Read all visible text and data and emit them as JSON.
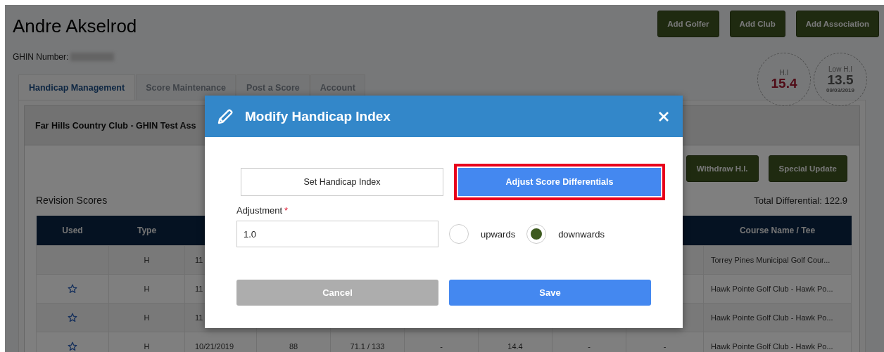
{
  "golfer": {
    "name": "Andre Akselrod",
    "ghin_label": "GHIN Number:"
  },
  "header_buttons": [
    "Add Golfer",
    "Add Club",
    "Add Association"
  ],
  "indexes": [
    {
      "label": "H.I",
      "value": "15.4",
      "kind": "current"
    },
    {
      "label": "Low H.I",
      "value": "13.5",
      "date": "09/03/2019",
      "kind": "low"
    }
  ],
  "tabs": [
    {
      "label": "Handicap Management",
      "selected": true
    },
    {
      "label": "Score Maintenance",
      "selected": false
    },
    {
      "label": "Post a Score",
      "selected": false
    },
    {
      "label": "Account",
      "selected": false
    }
  ],
  "card": {
    "title": "Far Hills Country Club - GHIN Test Ass",
    "actions": [
      "Withdraw H.I.",
      "Special Update"
    ],
    "section_title": "Revision Scores",
    "total": "Total Differential: 122.9"
  },
  "table": {
    "columns": [
      "Used",
      "Type",
      "",
      "",
      "",
      "",
      "",
      "",
      "",
      "Course Name / Tee"
    ],
    "rows": [
      {
        "used": false,
        "cells": [
          "",
          "H",
          "11",
          "",
          "",
          "",
          "",
          "",
          "",
          "Torrey Pines Municipal Golf Cour..."
        ]
      },
      {
        "used": true,
        "cells": [
          "",
          "H",
          "11",
          "",
          "",
          "",
          "",
          "",
          "",
          "Hawk Pointe Golf Club - Hawk Po..."
        ]
      },
      {
        "used": true,
        "cells": [
          "",
          "H",
          "11",
          "",
          "",
          "",
          "",
          "",
          "",
          "Hawk Pointe Golf Club - Hawk Po..."
        ]
      },
      {
        "used": true,
        "cells": [
          "",
          "H",
          "10/21/2019",
          "88",
          "71.1 / 133",
          "-",
          "14.4",
          "-",
          "-",
          "Hawk Pointe Golf Club - Hawk Po..."
        ]
      }
    ]
  },
  "dialog": {
    "title": "Modify Handicap Index",
    "modes": [
      {
        "label": "Set Handicap Index",
        "selected": false,
        "highlighted": false
      },
      {
        "label": "Adjust Score Differentials",
        "selected": true,
        "highlighted": true
      }
    ],
    "field": {
      "label": "Adjustment",
      "required_mark": "*",
      "value": "1.0"
    },
    "directions": [
      {
        "label": "upwards",
        "selected": false
      },
      {
        "label": "downwards",
        "selected": true
      }
    ],
    "buttons": [
      {
        "label": "Cancel",
        "kind": "secondary"
      },
      {
        "label": "Save",
        "kind": "primary"
      }
    ]
  }
}
